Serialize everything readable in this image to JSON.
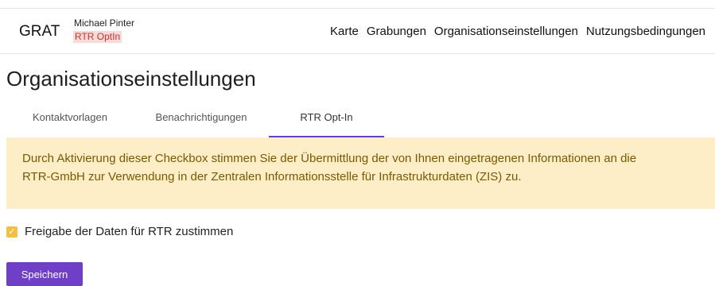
{
  "header": {
    "brand": "GRAT",
    "user_name": "Michael Pinter",
    "organization": "RTR OptIn",
    "nav": [
      "Karte",
      "Grabungen",
      "Organisationseinstellungen",
      "Nutzungsbedingungen"
    ]
  },
  "page": {
    "title": "Organisationseinstellungen"
  },
  "tabs": [
    {
      "label": "Kontaktvorlagen",
      "active": false
    },
    {
      "label": "Benachrichtigungen",
      "active": false
    },
    {
      "label": "RTR Opt-In",
      "active": true
    }
  ],
  "notice": {
    "line1": "Durch Aktivierung dieser Checkbox stimmen Sie der Übermittlung der von Ihnen eingetragenen Informationen an die",
    "line2": "RTR-GmbH zur Verwendung in der Zentralen Informationsstelle für Infrastrukturdaten (ZIS) zu."
  },
  "consent": {
    "label": "Freigabe der Daten für RTR zustimmen",
    "checked": true,
    "check_glyph": "✓"
  },
  "actions": {
    "save_label": "Speichern"
  },
  "colors": {
    "accent": "#6f3fc7",
    "notice_bg": "#fdeec8",
    "notice_text": "#7a5a00",
    "checkbox": "#f3c044",
    "badge_bg": "#f9dada",
    "badge_text": "#c0392b"
  }
}
